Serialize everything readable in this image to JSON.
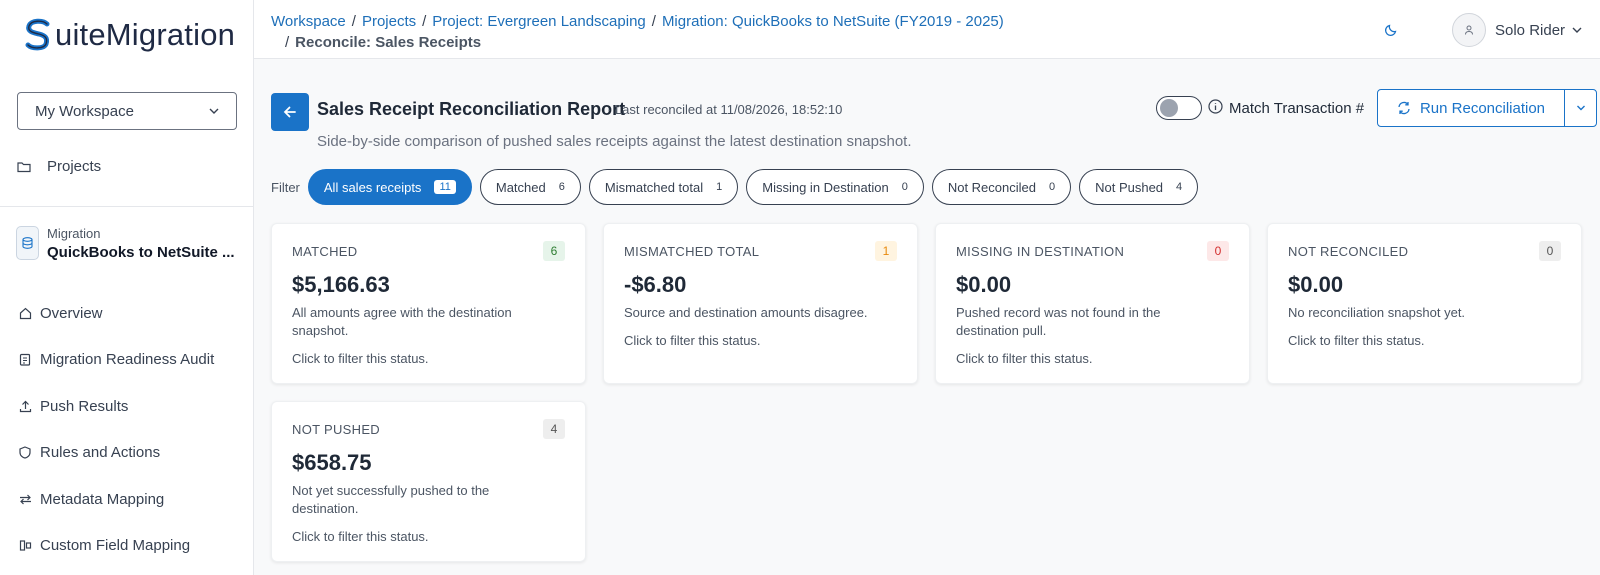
{
  "app": {
    "logo_text": "uiteMigration"
  },
  "sidebar": {
    "workspace": "My Workspace",
    "projects_label": "Projects",
    "migration_small": "Migration",
    "migration_name": "QuickBooks to NetSuite ...",
    "items": [
      {
        "label": "Overview",
        "icon": "home-icon"
      },
      {
        "label": "Migration Readiness Audit",
        "icon": "clipboard-icon"
      },
      {
        "label": "Push Results",
        "icon": "upload-icon"
      },
      {
        "label": "Rules and Actions",
        "icon": "shield-icon"
      },
      {
        "label": "Metadata Mapping",
        "icon": "arrows-icon"
      },
      {
        "label": "Custom Field Mapping",
        "icon": "fields-icon"
      }
    ]
  },
  "breadcrumb": {
    "items": [
      "Workspace",
      "Projects",
      "Project: Evergreen Landscaping",
      "Migration: QuickBooks to NetSuite (FY2019 - 2025)"
    ],
    "current": "Reconcile: Sales Receipts"
  },
  "user": {
    "name": "Solo Rider"
  },
  "header": {
    "title": "Sales Receipt Reconciliation Report",
    "last_reconciled": "· Last reconciled at 11/08/2026, 18:52:10",
    "match_label": "Match Transaction #",
    "run_label": "Run Reconciliation",
    "subtitle": "Side-by-side comparison of pushed sales receipts against the latest destination snapshot."
  },
  "filter": {
    "label": "Filter",
    "pills": [
      {
        "label": "All sales receipts",
        "count": "11",
        "active": true
      },
      {
        "label": "Matched",
        "count": "6"
      },
      {
        "label": "Mismatched total",
        "count": "1"
      },
      {
        "label": "Missing in Destination",
        "count": "0"
      },
      {
        "label": "Not Reconciled",
        "count": "0"
      },
      {
        "label": "Not Pushed",
        "count": "4"
      }
    ]
  },
  "cards": [
    {
      "title": "MATCHED",
      "count": "6",
      "amount": "$5,166.63",
      "desc": "All amounts agree with the destination snapshot.",
      "hint": "Click to filter this status.",
      "badge_bg": "#e6f4ea",
      "badge_fg": "#2e7d32"
    },
    {
      "title": "MISMATCHED TOTAL",
      "count": "1",
      "amount": "-$6.80",
      "desc": "Source and destination amounts disagree.",
      "hint": "Click to filter this status.",
      "badge_bg": "#fff4e0",
      "badge_fg": "#e8890c"
    },
    {
      "title": "MISSING IN DESTINATION",
      "count": "0",
      "amount": "$0.00",
      "desc": "Pushed record was not found in the destination pull.",
      "hint": "Click to filter this status.",
      "badge_bg": "#fde8e8",
      "badge_fg": "#d32f2f"
    },
    {
      "title": "NOT RECONCILED",
      "count": "0",
      "amount": "$0.00",
      "desc": "No reconciliation snapshot yet.",
      "hint": "Click to filter this status.",
      "badge_bg": "#eeeeee",
      "badge_fg": "#555555"
    },
    {
      "title": "NOT PUSHED",
      "count": "4",
      "amount": "$658.75",
      "desc": "Not yet successfully pushed to the destination.",
      "hint": "Click to filter this status.",
      "badge_bg": "#eeeeee",
      "badge_fg": "#555555"
    }
  ]
}
